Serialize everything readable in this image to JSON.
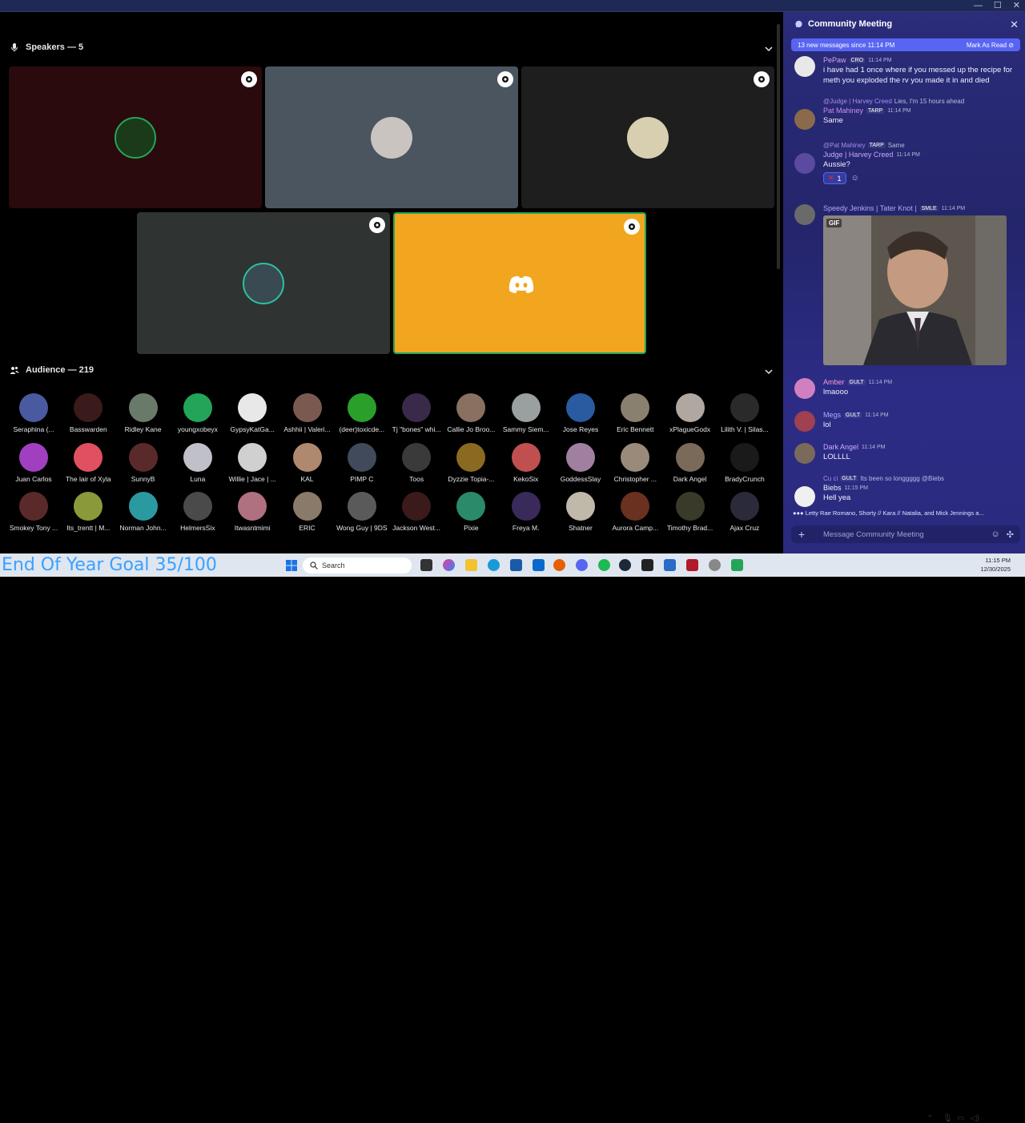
{
  "speakers": {
    "label": "Speakers — 5"
  },
  "audience": {
    "label": "Audience — 219",
    "members": [
      {
        "name": "Seraphina (...",
        "color": "#4a5aa0"
      },
      {
        "name": "Basswarden",
        "color": "#3a1a1a"
      },
      {
        "name": "Ridley Kane",
        "color": "#6a7a6a"
      },
      {
        "name": "youngxobeyx",
        "color": "#23a559"
      },
      {
        "name": "GypsyKatGa...",
        "color": "#e8e8e8"
      },
      {
        "name": "Ashhii | Valeri...",
        "color": "#7a5a50"
      },
      {
        "name": "(deer)toxicde...",
        "color": "#2aa02a"
      },
      {
        "name": "Tj \"bones\" whi...",
        "color": "#3a2a4a"
      },
      {
        "name": "Callie Jo Broo...",
        "color": "#8a7060"
      },
      {
        "name": "Sammy Siem...",
        "color": "#9aa0a0"
      },
      {
        "name": "Jose Reyes",
        "color": "#2a5aa0"
      },
      {
        "name": "Eric Bennett",
        "color": "#8a8070"
      },
      {
        "name": "xPlagueGodx",
        "color": "#b0a8a0"
      },
      {
        "name": "Lilith V. | Silas...",
        "color": "#2a2a2a"
      },
      {
        "name": "Juan Carlos",
        "color": "#a040c0"
      },
      {
        "name": "The lair of Xyla",
        "color": "#e05060"
      },
      {
        "name": "SunnyB",
        "color": "#5a2a2a"
      },
      {
        "name": "Luna",
        "color": "#c0c0c8"
      },
      {
        "name": "Willie | Jace | ...",
        "color": "#d0d0d0"
      },
      {
        "name": "KAL",
        "color": "#b08870"
      },
      {
        "name": "PIMP C",
        "color": "#404a5a"
      },
      {
        "name": "Toos",
        "color": "#3a3a3a"
      },
      {
        "name": "Dyzzie Topia-...",
        "color": "#8a6a20"
      },
      {
        "name": "KekoSix",
        "color": "#c05050"
      },
      {
        "name": "GoddessSlay",
        "color": "#a080a0"
      },
      {
        "name": "Christopher ...",
        "color": "#9a8a7a"
      },
      {
        "name": "Dark Angel",
        "color": "#7a6a5a"
      },
      {
        "name": "BradyCrunch",
        "color": "#1a1a1a"
      },
      {
        "name": "Smokey Tony ...",
        "color": "#5a2a2a"
      },
      {
        "name": "Its_trentt | M...",
        "color": "#8a9a3a"
      },
      {
        "name": "Norman John...",
        "color": "#2a9aa0"
      },
      {
        "name": "HelmersSix",
        "color": "#4a4a4a"
      },
      {
        "name": "Itwasntmimi",
        "color": "#b07080"
      },
      {
        "name": "ERIC",
        "color": "#8a7a6a"
      },
      {
        "name": "Wong Guy | 9DS",
        "color": "#5a5a5a"
      },
      {
        "name": "Jackson West...",
        "color": "#3a1a1a"
      },
      {
        "name": "Pixie",
        "color": "#2a8a6a"
      },
      {
        "name": "Freya M.",
        "color": "#3a2a5a"
      },
      {
        "name": "Shatner",
        "color": "#c0b8a8"
      },
      {
        "name": "Aurora Camp...",
        "color": "#6a3020"
      },
      {
        "name": "Timothy Brad...",
        "color": "#3a3a2a"
      },
      {
        "name": "Ajax Cruz",
        "color": "#2a2a3a"
      }
    ]
  },
  "chat": {
    "title": "Community Meeting",
    "new_messages": "13 new messages since 11:14 PM",
    "mark_read": "Mark As Read",
    "messages": [
      {
        "user": "PePaw",
        "tag": "CRO",
        "time": "11:14 PM",
        "text": "i have had 1 once where if you messed up the recipe for meth you exploded the rv you made it in and died",
        "color": "#d4a0f0"
      },
      {
        "reply_user": "@Judge | Harvey Creed",
        "reply_text": "Lies, I'm 15 hours ahead",
        "user": "Pat Mahiney",
        "tag": "TARP",
        "time": "11:14 PM",
        "text": "Same",
        "color": "#c98ff0"
      },
      {
        "reply_user": "@Pat Mahiney",
        "reply_tag": "TARP",
        "reply_text": "Same",
        "user": "Judge | Harvey Creed",
        "time": "11:14 PM",
        "text": "Aussie?",
        "reaction": "1",
        "color": "#c7a8ff"
      },
      {
        "user": "Speedy Jenkins | Tater Knot |",
        "tag": "SMLE",
        "time": "11:14 PM",
        "gif_label": "GIF",
        "color": "#b6a6ff"
      },
      {
        "user": "Amber",
        "tag": "GULT",
        "time": "11:14 PM",
        "text": "lmaooo",
        "color": "#ff9ad8"
      },
      {
        "user": "Megs",
        "tag": "GULT",
        "time": "11:14 PM",
        "text": "lol",
        "color": "#b8a8ff"
      },
      {
        "user": "Dark Angel",
        "time": "11:14 PM",
        "text": "LOLLLL",
        "color": "#d0a8ff"
      },
      {
        "reply_user": "Cu ci",
        "reply_tag": "GULT",
        "reply_text": "Its been so longgggg @Biebs",
        "user": "Biebs",
        "time": "11:15 PM",
        "text": "Hell yea",
        "color": "#f0f0ff"
      }
    ],
    "typing": "Letty Rae Romano, Shorty // Kara // Natalia, and Mick Jennings a...",
    "input_placeholder": "Message Community Meeting"
  },
  "overlay": {
    "goal_text": "End Of Year Goal 35/100"
  },
  "taskbar": {
    "search_placeholder": "Search",
    "time": "11:15 PM",
    "date": "12/30/2025"
  },
  "colors": {
    "discord_blurple": "#5865f2",
    "speaker_active": "#f2a51f",
    "speaking_ring": "#23a559"
  }
}
